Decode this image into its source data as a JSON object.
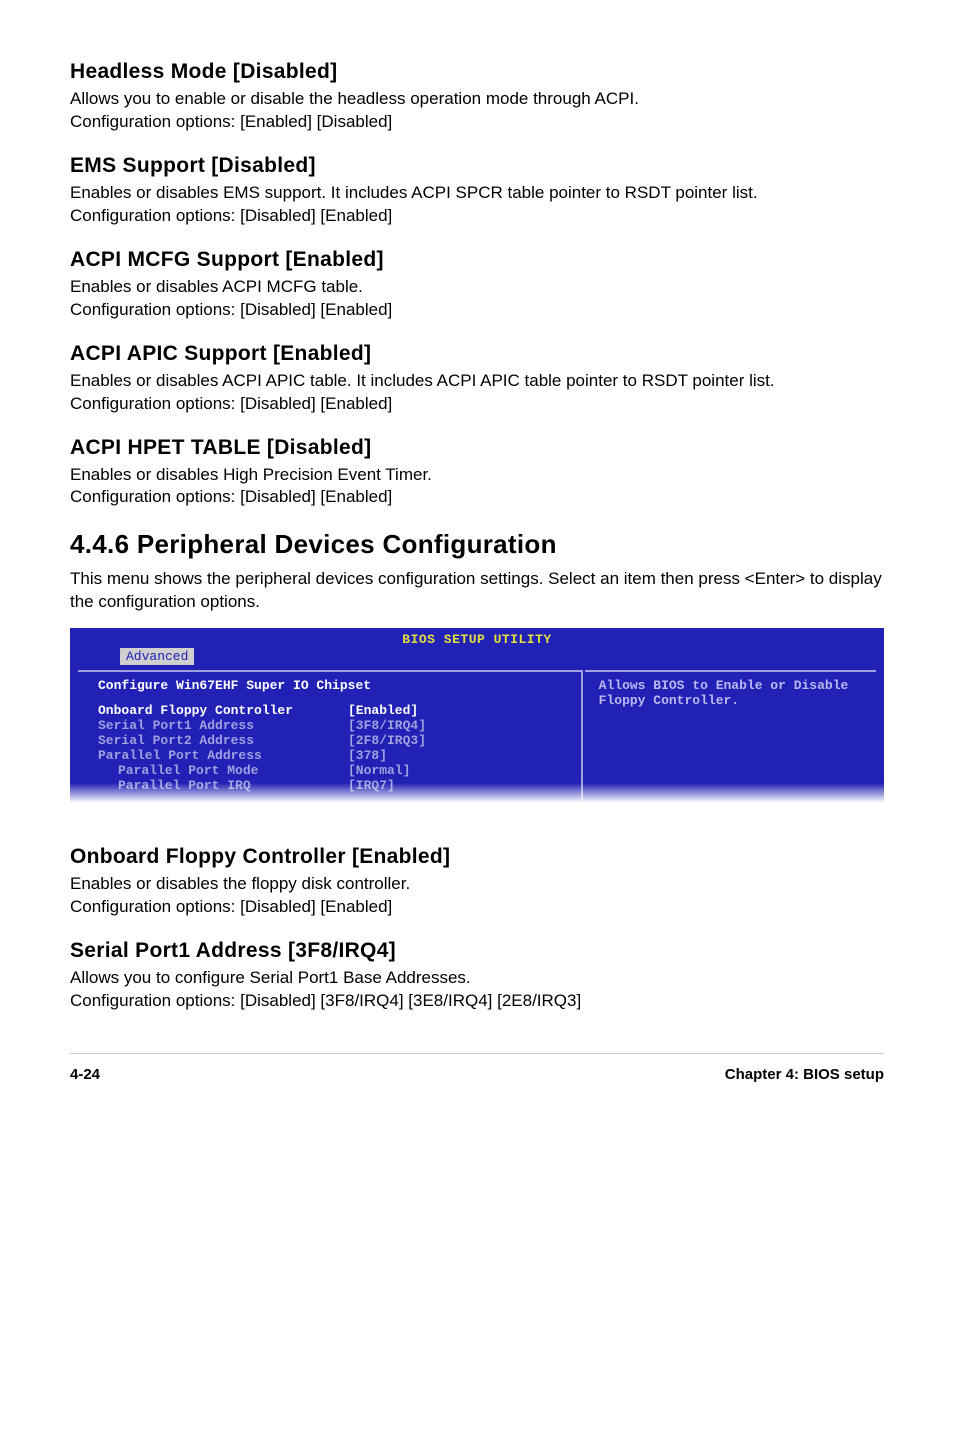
{
  "sections": {
    "headless": {
      "heading": "Headless Mode [Disabled]",
      "body1": "Allows you to enable or disable the headless operation mode through ACPI.",
      "body2": "Configuration options: [Enabled] [Disabled]"
    },
    "ems": {
      "heading": "EMS Support [Disabled]",
      "body1": "Enables or disables EMS support. It includes ACPI SPCR table pointer to RSDT pointer list.",
      "body2": "Configuration options: [Disabled] [Enabled]"
    },
    "mcfg": {
      "heading": "ACPI MCFG Support [Enabled]",
      "body1": "Enables or disables ACPI MCFG table.",
      "body2": "Configuration options: [Disabled] [Enabled]"
    },
    "apic": {
      "heading": "ACPI APIC Support [Enabled]",
      "body1": "Enables or disables ACPI APIC table. It includes ACPI APIC table pointer to RSDT pointer list.",
      "body2": "Configuration options: [Disabled] [Enabled]"
    },
    "hpet": {
      "heading": "ACPI HPET TABLE [Disabled]",
      "body1": "Enables or disables High Precision Event Timer.",
      "body2": "Configuration options: [Disabled] [Enabled]"
    }
  },
  "major": {
    "heading": "4.4.6   Peripheral Devices Configuration",
    "body": "This menu shows the peripheral devices configuration settings. Select an item then press <Enter> to display the configuration options."
  },
  "bios": {
    "title": "BIOS SETUP UTILITY",
    "tab": "Advanced",
    "config_title": "Configure Win67EHF Super IO Chipset",
    "rows": [
      {
        "label": "Onboard Floppy Controller",
        "value": "[Enabled]",
        "selected": true,
        "indent": false
      },
      {
        "label": "Serial Port1 Address",
        "value": "[3F8/IRQ4]",
        "selected": false,
        "indent": false
      },
      {
        "label": "Serial Port2 Address",
        "value": "[2F8/IRQ3]",
        "selected": false,
        "indent": false
      },
      {
        "label": "Parallel Port Address",
        "value": "[378]",
        "selected": false,
        "indent": false
      },
      {
        "label": "Parallel Port Mode",
        "value": "[Normal]",
        "selected": false,
        "indent": true
      },
      {
        "label": "Parallel Port IRQ",
        "value": "[IRQ7]",
        "selected": false,
        "indent": true
      }
    ],
    "help": "Allows BIOS to Enable or Disable Floppy Controller."
  },
  "post_sections": {
    "floppy": {
      "heading": "Onboard Floppy Controller [Enabled]",
      "body1": "Enables or disables the floppy disk controller.",
      "body2": "Configuration options: [Disabled] [Enabled]"
    },
    "serial1": {
      "heading": "Serial Port1 Address [3F8/IRQ4]",
      "body1": "Allows you to configure Serial Port1 Base Addresses.",
      "body2": "Configuration options: [Disabled] [3F8/IRQ4] [3E8/IRQ4] [2E8/IRQ3]"
    }
  },
  "footer": {
    "left": "4-24",
    "right": "Chapter 4: BIOS setup"
  }
}
